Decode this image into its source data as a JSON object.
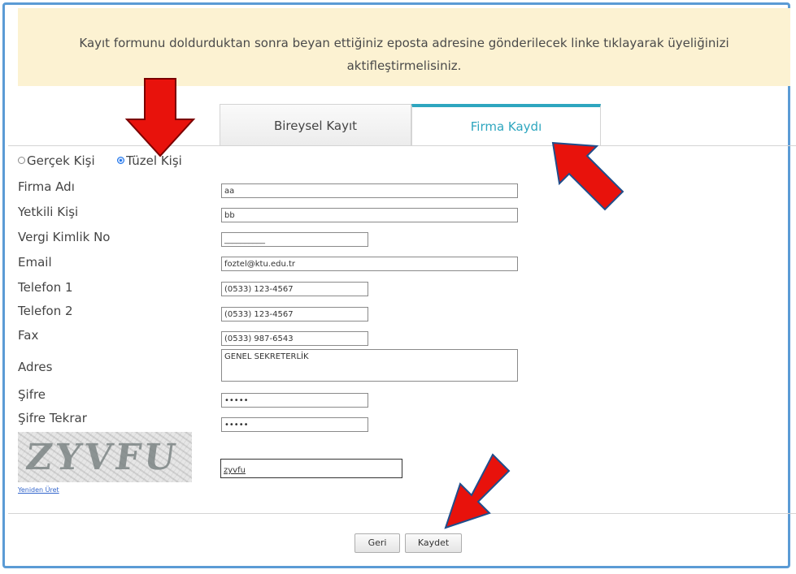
{
  "notice": {
    "line1": "Kayıt formunu doldurduktan sonra beyan ettiğiniz eposta adresine gönderilecek linke tıklayarak üyeliğinizi",
    "line2": "aktifleştirmelisiniz."
  },
  "tabs": [
    {
      "label": "Bireysel Kayıt",
      "active": false
    },
    {
      "label": "Firma Kaydı",
      "active": true
    }
  ],
  "person_type": {
    "options": [
      "Gerçek Kişi",
      "Tüzel Kişi"
    ],
    "selected": "Tüzel Kişi"
  },
  "form": {
    "firma_adi": {
      "label": "Firma Adı",
      "value": "aa"
    },
    "yetkili_kisi": {
      "label": "Yetkili Kişi",
      "value": "bb"
    },
    "vergi_no": {
      "label": "Vergi Kimlik No",
      "value": "__________"
    },
    "email": {
      "label": "Email",
      "value": "foztel@ktu.edu.tr"
    },
    "telefon1": {
      "label": "Telefon 1",
      "value": "(0533) 123-4567"
    },
    "telefon2": {
      "label": "Telefon 2",
      "value": "(0533) 123-4567"
    },
    "fax": {
      "label": "Fax",
      "value": "(0533) 987-6543"
    },
    "adres": {
      "label": "Adres",
      "value": "GENEL SEKRETERLİK"
    },
    "sifre": {
      "label": "Şifre",
      "value": "•••••"
    },
    "sifre_tekrar": {
      "label": "Şifre Tekrar",
      "value": "•••••"
    }
  },
  "captcha": {
    "image_text": "ZYVFU",
    "regen_label": "Yeniden Üret",
    "input_value": "zyvfu"
  },
  "buttons": {
    "back": "Geri",
    "save": "Kaydet"
  },
  "colors": {
    "notice_bg": "#fcf2d2",
    "tab_accent": "#2ea6bf",
    "frame_border": "#5b9bd5",
    "annotation_arrow": "#e8120c"
  }
}
